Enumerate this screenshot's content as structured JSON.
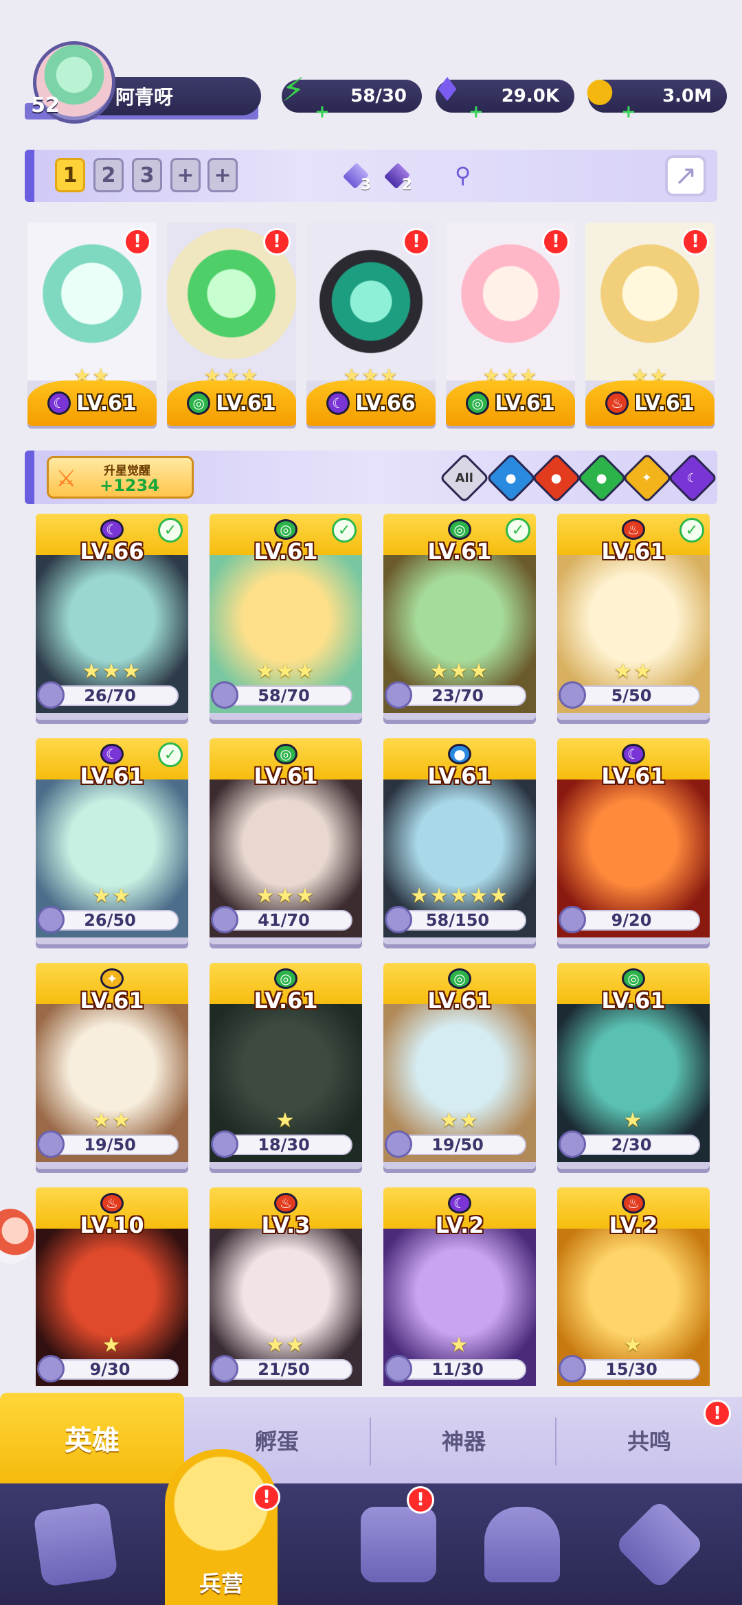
{
  "player": {
    "level": "52",
    "name": "阿青呀"
  },
  "resources": [
    {
      "name": "energy",
      "value": "58/30",
      "icon": "lightning-icon",
      "color": "#39d24b"
    },
    {
      "name": "gems",
      "value": "29.0K",
      "icon": "diamond-icon",
      "color": "#7b5cf0"
    },
    {
      "name": "gold",
      "value": "3.0M",
      "icon": "coin-icon",
      "color": "#f4b70f"
    }
  ],
  "team_tabs": [
    "1",
    "2",
    "3"
  ],
  "team_tab_active": "1",
  "team_add_tabs": [
    "+",
    "+"
  ],
  "team_gems": [
    {
      "count": "3"
    },
    {
      "count": "2"
    }
  ],
  "team": [
    {
      "level": "LV.61",
      "element": "dark",
      "stars": 2,
      "alert": "!"
    },
    {
      "level": "LV.61",
      "element": "wind",
      "stars": 3,
      "alert": "!"
    },
    {
      "level": "LV.66",
      "element": "dark",
      "stars": 3,
      "alert": "!"
    },
    {
      "level": "LV.61",
      "element": "wind",
      "stars": 3,
      "alert": "!"
    },
    {
      "level": "LV.61",
      "element": "fire",
      "stars": 2,
      "alert": "!"
    }
  ],
  "awaken": {
    "title": "升星觉醒",
    "value": "+1234"
  },
  "filters": {
    "all_label": "All",
    "elements": [
      "water",
      "fire",
      "wind",
      "light",
      "dark"
    ]
  },
  "heroes": [
    {
      "level": "LV.66",
      "element": "dark",
      "shards": "26/70",
      "stars": 3,
      "checked": true,
      "art": [
        "#9ad7d0",
        "#2d3a48"
      ]
    },
    {
      "level": "LV.61",
      "element": "wind",
      "shards": "58/70",
      "stars": 3,
      "checked": true,
      "art": [
        "#ffe08a",
        "#78c7a0"
      ]
    },
    {
      "level": "LV.61",
      "element": "wind",
      "shards": "23/70",
      "stars": 3,
      "checked": true,
      "art": [
        "#a6dc9a",
        "#6b5a2c"
      ]
    },
    {
      "level": "LV.61",
      "element": "fire",
      "shards": "5/50",
      "stars": 2,
      "checked": true,
      "art": [
        "#fff3d2",
        "#d8b060"
      ]
    },
    {
      "level": "LV.61",
      "element": "dark",
      "shards": "26/50",
      "stars": 2,
      "checked": true,
      "art": [
        "#c8f0e2",
        "#4c6e8a"
      ]
    },
    {
      "level": "LV.61",
      "element": "wind",
      "shards": "41/70",
      "stars": 3,
      "checked": false,
      "art": [
        "#e8d8d0",
        "#3c2c30"
      ]
    },
    {
      "level": "LV.61",
      "element": "water",
      "shards": "58/150",
      "stars": 5,
      "checked": false,
      "art": [
        "#a9d8e8",
        "#2a3340"
      ]
    },
    {
      "level": "LV.61",
      "element": "dark",
      "shards": "9/20",
      "stars": 0,
      "checked": false,
      "art": [
        "#ff8a3c",
        "#8a1a10"
      ]
    },
    {
      "level": "LV.61",
      "element": "light",
      "shards": "19/50",
      "stars": 2,
      "checked": false,
      "art": [
        "#f7eedd",
        "#9a6a48"
      ]
    },
    {
      "level": "LV.61",
      "element": "wind",
      "shards": "18/30",
      "stars": 1,
      "checked": false,
      "art": [
        "#3c4a40",
        "#1e2a24"
      ]
    },
    {
      "level": "LV.61",
      "element": "wind",
      "shards": "19/50",
      "stars": 2,
      "checked": false,
      "art": [
        "#d5ecf2",
        "#b28a5a"
      ]
    },
    {
      "level": "LV.61",
      "element": "wind",
      "shards": "2/30",
      "stars": 1,
      "checked": false,
      "art": [
        "#5ac0b0",
        "#1c2a34"
      ]
    },
    {
      "level": "LV.10",
      "element": "fire",
      "shards": "9/30",
      "stars": 1,
      "checked": false,
      "art": [
        "#e04a2c",
        "#301010"
      ]
    },
    {
      "level": "LV.3",
      "element": "fire",
      "shards": "21/50",
      "stars": 2,
      "checked": false,
      "art": [
        "#f2e4e6",
        "#3a2c34"
      ]
    },
    {
      "level": "LV.2",
      "element": "dark",
      "shards": "11/30",
      "stars": 1,
      "checked": false,
      "art": [
        "#c9a4f0",
        "#4a2a7a"
      ]
    },
    {
      "level": "LV.2",
      "element": "fire",
      "shards": "15/30",
      "stars": 1,
      "checked": false,
      "art": [
        "#ffd56a",
        "#c87a10"
      ]
    }
  ],
  "sub_tabs": {
    "hero": "英雄",
    "hatch": "孵蛋",
    "artifact": "神器",
    "resonance": "共鸣",
    "resonance_alert": "!"
  },
  "nav": {
    "active_label": "兵营",
    "barracks_alert": "!",
    "map_alert": "!"
  }
}
